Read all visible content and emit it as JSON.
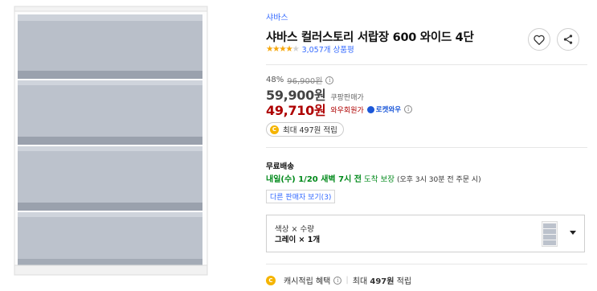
{
  "product": {
    "brand": "샤바스",
    "title": "샤바스 컬러스토리 서랍장 600 와이드 4단",
    "rating_stars": 4.5,
    "review_count": "3,057개 상품평",
    "image_icon": "drawer-cabinet-product-image"
  },
  "pricing": {
    "discount_rate": "48%",
    "original_price": "96,900원",
    "sale_price": "59,900원",
    "sale_label": "쿠팡판매가",
    "member_price": "49,710원",
    "member_label": "와우회원가",
    "rocket_wow": "로켓와우",
    "cash_reward": "최대 497원 적립"
  },
  "shipping": {
    "title": "무료배송",
    "eta": "내일(수) 1/20 새벽 7시 전",
    "guarantee": "도착 보장",
    "cutoff": "(오후 3시 30분 전 주문 시)"
  },
  "other_seller_label": "다른 판매자 보기(3)",
  "option": {
    "label": "색상 × 수량",
    "value": "그레이 × 1개"
  },
  "cashback": {
    "label": "캐시적립 혜택",
    "max_prefix": "최대",
    "max_amount": "497원",
    "suffix": "적립"
  },
  "icons": {
    "heart": "heart-icon",
    "share": "share-icon",
    "info": "info-icon",
    "coin": "coin-icon",
    "rocket": "rocket-wow-icon",
    "caret": "chevron-down-icon"
  },
  "colors": {
    "link_blue": "#346aff",
    "member_red": "#ae0000",
    "ship_green": "#00891a",
    "star": "#f6a609",
    "coin": "#f5b400"
  }
}
